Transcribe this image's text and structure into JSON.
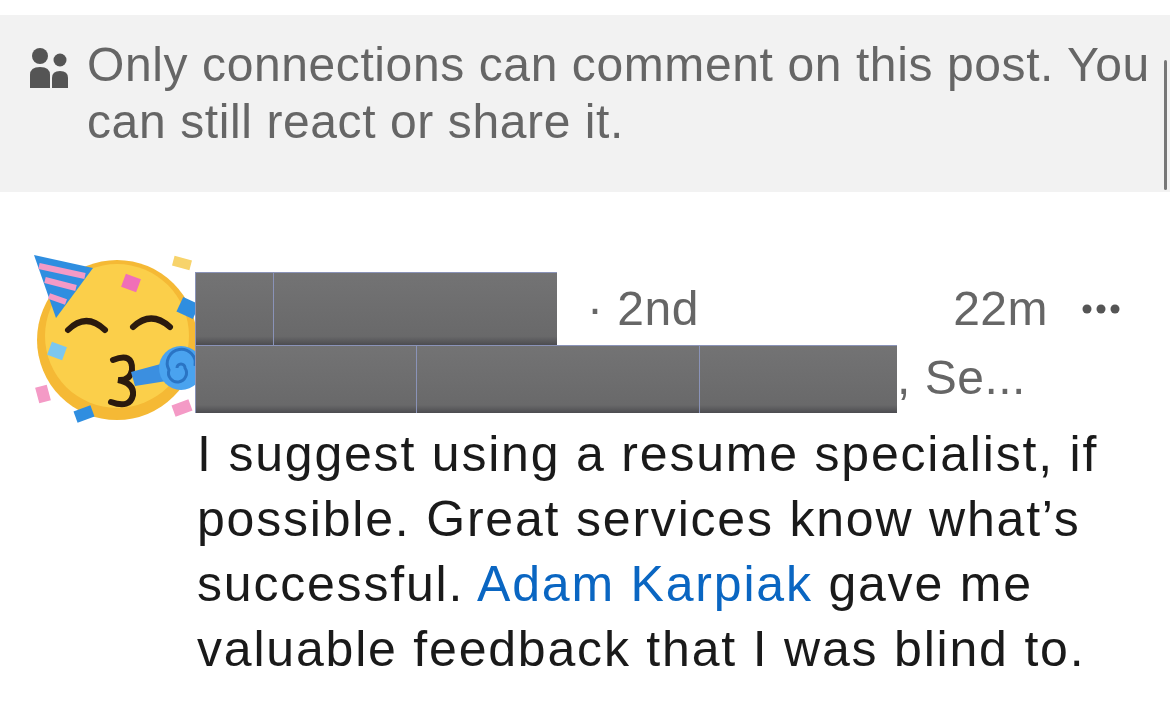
{
  "notice": {
    "text": "Only connections can comment on this post. You can still react or share it."
  },
  "comment": {
    "author": {
      "degree": "· 2nd",
      "headline": ", Se..."
    },
    "time": "22m",
    "body": [
      {
        "kind": "text",
        "text": "I suggest using a resume specialist, if possible. Great services know what’s successful. "
      },
      {
        "kind": "mention",
        "text": "Adam Karpiak"
      },
      {
        "kind": "text",
        "text": " gave me valuable feedback that I was blind to."
      }
    ]
  }
}
